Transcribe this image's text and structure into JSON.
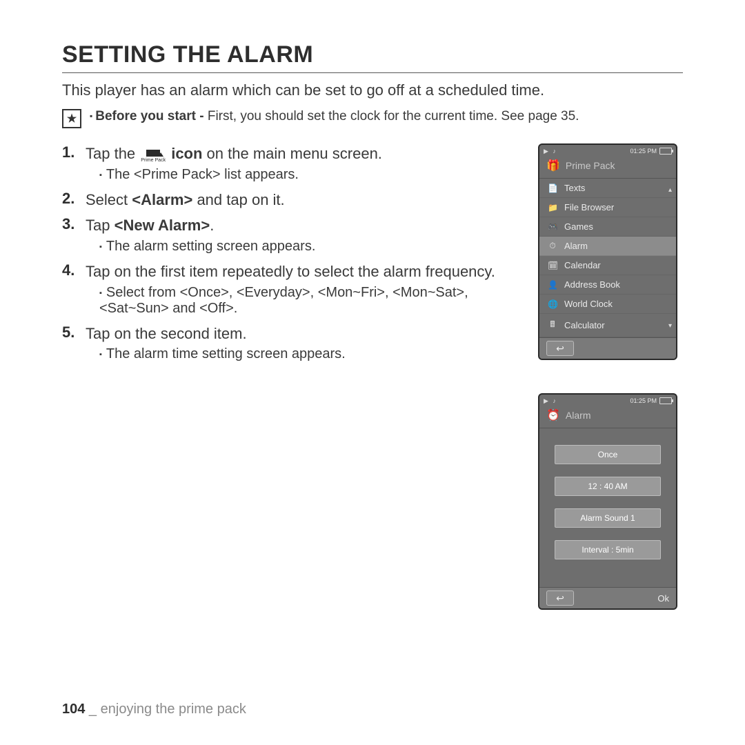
{
  "title": "SETTING THE ALARM",
  "intro": "This player has an alarm which can be set to go off at a scheduled time.",
  "note": {
    "bold": "Before you start -",
    "rest": " First, you should set the clock for the current time. See page 35."
  },
  "steps": {
    "s1_a": "Tap the ",
    "s1_b": " icon",
    "s1_c": " on the main menu screen.",
    "s1_sub": "The <Prime Pack> list appears.",
    "s2_a": "Select ",
    "s2_b": "<Alarm>",
    "s2_c": " and tap on it.",
    "s3_a": "Tap ",
    "s3_b": "<New Alarm>",
    "s3_c": ".",
    "s3_sub": "The alarm setting screen appears.",
    "s4": "Tap on the first item repeatedly to select the alarm frequency.",
    "s4_sub": "Select from <Once>, <Everyday>, <Mon~Fri>, <Mon~Sat>, <Sat~Sun> and <Off>.",
    "s5": "Tap on the second item.",
    "s5_sub": "The alarm time setting screen appears."
  },
  "icon_caption": "Prime Pack",
  "device1": {
    "time": "01:25 PM",
    "header": "Prime Pack",
    "items": [
      {
        "icon": "📄",
        "label": "Texts"
      },
      {
        "icon": "📁",
        "label": "File Browser"
      },
      {
        "icon": "🎮",
        "label": "Games"
      },
      {
        "icon": "⏱",
        "label": "Alarm",
        "selected": true
      },
      {
        "icon": "🗓",
        "label": "Calendar"
      },
      {
        "icon": "👤",
        "label": "Address Book"
      },
      {
        "icon": "🌐",
        "label": "World Clock"
      },
      {
        "icon": "🖩",
        "label": "Calculator"
      }
    ]
  },
  "device2": {
    "time": "01:25 PM",
    "header": "Alarm",
    "rows": [
      "Once",
      "12 : 40 AM",
      "Alarm Sound 1",
      "Interval : 5min"
    ],
    "ok": "Ok"
  },
  "footer": {
    "page": "104",
    "sep": " _ ",
    "section": "enjoying the prime pack"
  }
}
